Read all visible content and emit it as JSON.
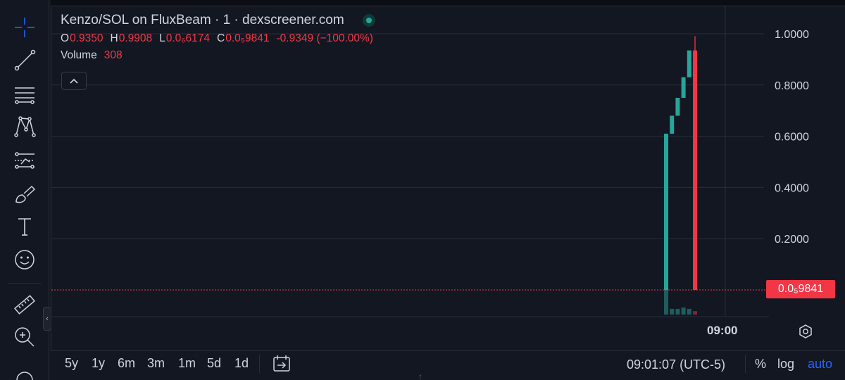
{
  "legend": {
    "title": "Kenzo/SOL on FluxBeam · 1 · dexscreener.com",
    "ohlc": [
      {
        "key": "O",
        "value": "0.9350"
      },
      {
        "key": "H",
        "value": "0.9908"
      },
      {
        "key": "L",
        "value": "0.0₆6174"
      },
      {
        "key": "C",
        "value": "0.0₅9841"
      }
    ],
    "change": "-0.9349 (−100.00%)",
    "volume_label": "Volume",
    "volume_value": "308"
  },
  "price_tag": "0.0₅9841",
  "time_axis": {
    "label": "09:00"
  },
  "bottom": {
    "ranges": [
      "5y",
      "1y",
      "6m",
      "3m",
      "1m",
      "5d",
      "1d"
    ],
    "clock": "09:01:07 (UTC-5)",
    "percent": "%",
    "log": "log",
    "auto": "auto"
  },
  "icons": {
    "tools": [
      "crosshair-icon",
      "trend-line-icon",
      "horizontal-lines-icon",
      "pattern-icon",
      "forecast-icon",
      "brush-icon",
      "text-icon",
      "emoji-icon",
      "ruler-icon",
      "zoom-icon"
    ],
    "settings": "gear-icon",
    "calendar": "goto-date-icon"
  },
  "colors": {
    "up": "#26a69a",
    "down": "#f23645",
    "background": "#131722",
    "grid": "#2a2e39",
    "text": "#d1d4dc",
    "accent": "#2962ff"
  },
  "chart_data": {
    "type": "candlestick",
    "title": "Kenzo/SOL on FluxBeam · 1 · dexscreener.com",
    "y_ticks": [
      "1.0000",
      "0.8000",
      "0.6000",
      "0.4000",
      "0.2000"
    ],
    "ylim": [
      0,
      1.0
    ],
    "grid": true,
    "last_price": 9.8e-06,
    "candles": [
      {
        "open": 0.0,
        "high": 0.61,
        "low": 0.0,
        "close": 0.61,
        "volume": 1.0
      },
      {
        "open": 0.61,
        "high": 0.68,
        "low": 0.61,
        "close": 0.68,
        "volume": 0.22
      },
      {
        "open": 0.68,
        "high": 0.75,
        "low": 0.68,
        "close": 0.75,
        "volume": 0.22
      },
      {
        "open": 0.75,
        "high": 0.83,
        "low": 0.75,
        "close": 0.83,
        "volume": 0.27
      },
      {
        "open": 0.83,
        "high": 0.935,
        "low": 0.83,
        "close": 0.935,
        "volume": 0.22
      },
      {
        "open": 0.935,
        "high": 0.9908,
        "low": 6e-07,
        "close": 9.8e-06,
        "volume": 0.13
      }
    ]
  }
}
